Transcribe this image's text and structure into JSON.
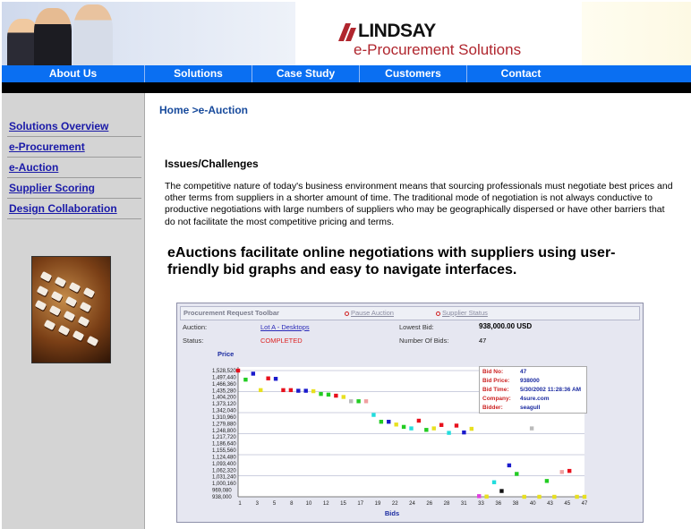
{
  "header": {
    "brand_name": "LINDSAY",
    "tagline": "e-Procurement Solutions",
    "colors": {
      "nav": "#0a6ff2",
      "brand_red": "#b0262e"
    }
  },
  "nav": {
    "items": [
      {
        "label": "About Us"
      },
      {
        "label": "Solutions"
      },
      {
        "label": "Case Study"
      },
      {
        "label": "Customers"
      },
      {
        "label": "Contact"
      }
    ]
  },
  "sidebar": {
    "links": [
      {
        "label": "Solutions Overview"
      },
      {
        "label": "e-Procurement"
      },
      {
        "label": "e-Auction"
      },
      {
        "label": "Supplier Scoring"
      },
      {
        "label": "Design Collaboration"
      }
    ]
  },
  "main": {
    "breadcrumb": "Home >e-Auction",
    "issues_heading": "Issues/Challenges",
    "issues_body": "The competitive nature of today's business environment means that sourcing professionals must negotiate best prices and other terms from suppliers in a shorter amount of time. The traditional mode of negotiation is not always conductive to productive negotiations with large numbers of suppliers who may be geographically dispersed or have other barriers that do not facilitate the most competitive pricing and terms.",
    "headline": "eAuctions facilitate online negotiations with suppliers using user-friendly bid graphs and easy to navigate interfaces."
  },
  "toolbar": {
    "title": "Procurement Request Toolbar",
    "pause_link": "Pause Auction",
    "status_link": "Supplier Status",
    "auction_label": "Auction:",
    "auction_value": "Lot A - Desktops",
    "status_label": "Status:",
    "status_value": "COMPLETED",
    "lowest_bid_label": "Lowest Bid:",
    "lowest_bid_value": "938,000.00 USD",
    "num_bids_label": "Number Of Bids:",
    "num_bids_value": "47"
  },
  "tooltip": {
    "rows": [
      {
        "key": "Bid No:",
        "value": "47"
      },
      {
        "key": "Bid Price:",
        "value": "938000"
      },
      {
        "key": "Bid Time:",
        "value": "5/30/2002 11:28:36 AM"
      },
      {
        "key": "Company:",
        "value": "4sure.com"
      },
      {
        "key": "Bidder:",
        "value": "seagull"
      }
    ]
  },
  "chart_data": {
    "type": "scatter",
    "ylabel": "Price",
    "xlabel": "Bids",
    "y_ticks": [
      "1,528,520",
      "1,497,440",
      "1,466,360",
      "1,435,280",
      "1,404,200",
      "1,373,120",
      "1,342,040",
      "1,310,960",
      "1,279,880",
      "1,248,800",
      "1,217,720",
      "1,186,640",
      "1,155,560",
      "1,124,480",
      "1,093,400",
      "1,062,320",
      "1,031,240",
      "1,000,160",
      "969,080",
      "938,000"
    ],
    "x_ticks": [
      "1",
      "3",
      "5",
      "8",
      "10",
      "12",
      "15",
      "17",
      "19",
      "22",
      "24",
      "26",
      "28",
      "31",
      "33",
      "36",
      "38",
      "40",
      "43",
      "45",
      "47"
    ],
    "ylim": [
      938000,
      1528520
    ],
    "xlim": [
      1,
      47
    ],
    "points": [
      {
        "x": 1,
        "y": 1528520,
        "color": "#e8101c"
      },
      {
        "x": 2,
        "y": 1486000,
        "color": "#22cc22"
      },
      {
        "x": 3,
        "y": 1514000,
        "color": "#1a1acc"
      },
      {
        "x": 4,
        "y": 1437000,
        "color": "#e8e020"
      },
      {
        "x": 5,
        "y": 1492000,
        "color": "#e8101c"
      },
      {
        "x": 6,
        "y": 1490000,
        "color": "#1a1acc"
      },
      {
        "x": 7,
        "y": 1437000,
        "color": "#e8101c"
      },
      {
        "x": 8,
        "y": 1437000,
        "color": "#e8101c"
      },
      {
        "x": 9,
        "y": 1434000,
        "color": "#1a1acc"
      },
      {
        "x": 10,
        "y": 1434000,
        "color": "#1a1acc"
      },
      {
        "x": 11,
        "y": 1432000,
        "color": "#e8e020"
      },
      {
        "x": 12,
        "y": 1419000,
        "color": "#22cc22"
      },
      {
        "x": 13,
        "y": 1416000,
        "color": "#22cc22"
      },
      {
        "x": 14,
        "y": 1411000,
        "color": "#e8101c"
      },
      {
        "x": 15,
        "y": 1405000,
        "color": "#e8e020"
      },
      {
        "x": 16,
        "y": 1385000,
        "color": "#bbbbbb"
      },
      {
        "x": 17,
        "y": 1385000,
        "color": "#22cc22"
      },
      {
        "x": 18,
        "y": 1385000,
        "color": "#f0a0a0"
      },
      {
        "x": 19,
        "y": 1321000,
        "color": "#22dddd"
      },
      {
        "x": 20,
        "y": 1289000,
        "color": "#22cc22"
      },
      {
        "x": 21,
        "y": 1289000,
        "color": "#1a1acc"
      },
      {
        "x": 22,
        "y": 1276000,
        "color": "#e8e020"
      },
      {
        "x": 23,
        "y": 1265000,
        "color": "#22cc22"
      },
      {
        "x": 24,
        "y": 1258000,
        "color": "#22dddd"
      },
      {
        "x": 25,
        "y": 1294000,
        "color": "#e8101c"
      },
      {
        "x": 26,
        "y": 1251000,
        "color": "#22cc22"
      },
      {
        "x": 27,
        "y": 1258000,
        "color": "#e8e020"
      },
      {
        "x": 28,
        "y": 1274000,
        "color": "#e8101c"
      },
      {
        "x": 29,
        "y": 1237000,
        "color": "#22dddd"
      },
      {
        "x": 30,
        "y": 1271000,
        "color": "#e8101c"
      },
      {
        "x": 31,
        "y": 1239000,
        "color": "#1a1acc"
      },
      {
        "x": 32,
        "y": 1256000,
        "color": "#e8e020"
      },
      {
        "x": 33,
        "y": 941000,
        "color": "#e040e0"
      },
      {
        "x": 34,
        "y": 939000,
        "color": "#e8e020"
      },
      {
        "x": 35,
        "y": 1006000,
        "color": "#22dddd"
      },
      {
        "x": 36,
        "y": 965000,
        "color": "#111111"
      },
      {
        "x": 37,
        "y": 1085000,
        "color": "#1a1acc"
      },
      {
        "x": 38,
        "y": 1045000,
        "color": "#22cc22"
      },
      {
        "x": 39,
        "y": 938000,
        "color": "#e8e020"
      },
      {
        "x": 40,
        "y": 1258000,
        "color": "#bbbbbb"
      },
      {
        "x": 41,
        "y": 938000,
        "color": "#e8e020"
      },
      {
        "x": 42,
        "y": 1012000,
        "color": "#22cc22"
      },
      {
        "x": 43,
        "y": 938000,
        "color": "#e8e020"
      },
      {
        "x": 44,
        "y": 1054000,
        "color": "#f0a0a0"
      },
      {
        "x": 45,
        "y": 1059000,
        "color": "#e8101c"
      },
      {
        "x": 46,
        "y": 938000,
        "color": "#e8e020"
      },
      {
        "x": 47,
        "y": 938000,
        "color": "#e8e020"
      }
    ]
  }
}
